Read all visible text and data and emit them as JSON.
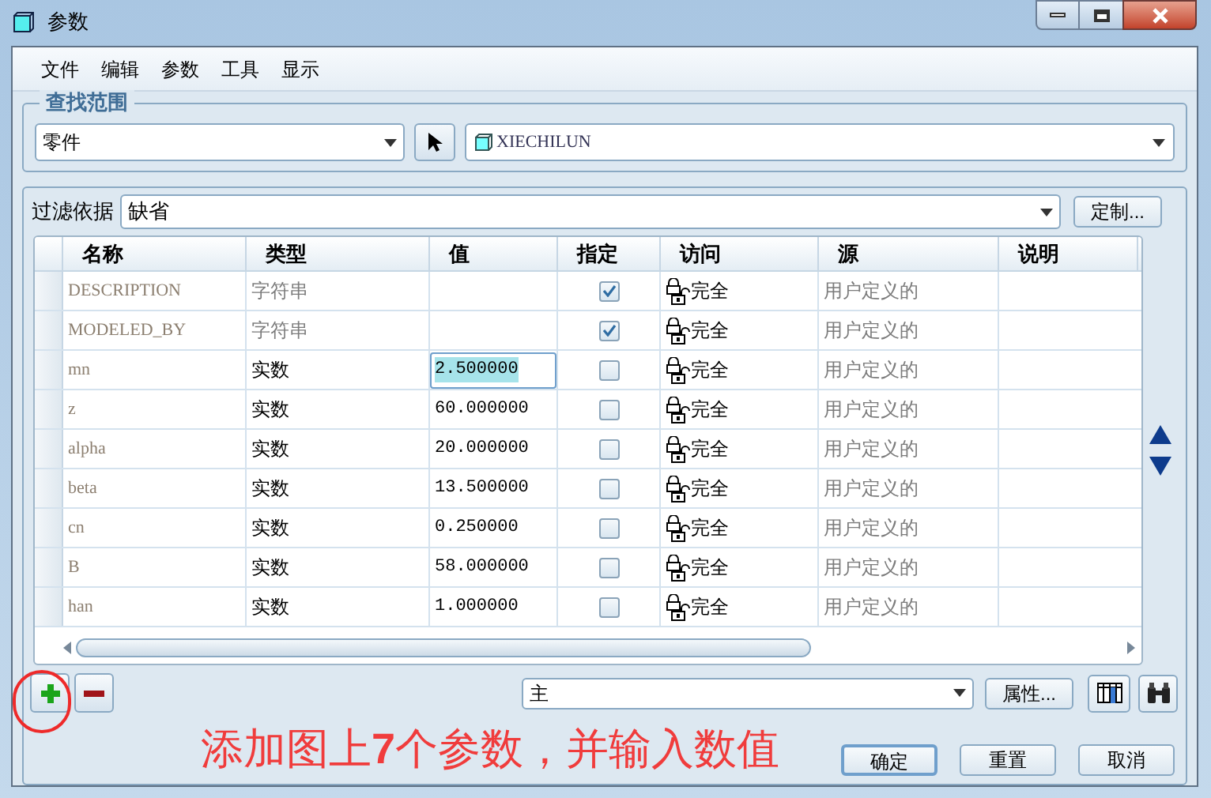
{
  "window": {
    "title": "参数"
  },
  "menu": [
    "文件",
    "编辑",
    "参数",
    "工具",
    "显示"
  ],
  "lookup": {
    "title": "查找范围",
    "scope": "零件",
    "model": "XIECHILUN"
  },
  "filter": {
    "label": "过滤依据",
    "value": "缺省",
    "button": "定制..."
  },
  "table": {
    "columns": [
      "名称",
      "类型",
      "值",
      "指定",
      "访问",
      "源",
      "说明"
    ],
    "rows": [
      {
        "name": "DESCRIPTION",
        "kind": "string",
        "type": "字符串",
        "value": "",
        "checked": true,
        "access": "完全",
        "source": "用户定义的",
        "editing": false
      },
      {
        "name": "MODELED_BY",
        "kind": "string",
        "type": "字符串",
        "value": "",
        "checked": true,
        "access": "完全",
        "source": "用户定义的",
        "editing": false
      },
      {
        "name": "mn",
        "kind": "real",
        "type": "实数",
        "value": "2.500000",
        "checked": false,
        "access": "完全",
        "source": "用户定义的",
        "editing": true
      },
      {
        "name": "z",
        "kind": "real",
        "type": "实数",
        "value": "60.000000",
        "checked": false,
        "access": "完全",
        "source": "用户定义的",
        "editing": false
      },
      {
        "name": "alpha",
        "kind": "real",
        "type": "实数",
        "value": "20.000000",
        "checked": false,
        "access": "完全",
        "source": "用户定义的",
        "editing": false
      },
      {
        "name": "beta",
        "kind": "real",
        "type": "实数",
        "value": "13.500000",
        "checked": false,
        "access": "完全",
        "source": "用户定义的",
        "editing": false
      },
      {
        "name": "cn",
        "kind": "real",
        "type": "实数",
        "value": "0.250000",
        "checked": false,
        "access": "完全",
        "source": "用户定义的",
        "editing": false
      },
      {
        "name": "B",
        "kind": "real",
        "type": "实数",
        "value": "58.000000",
        "checked": false,
        "access": "完全",
        "source": "用户定义的",
        "editing": false
      },
      {
        "name": "han",
        "kind": "real",
        "type": "实数",
        "value": "1.000000",
        "checked": false,
        "access": "完全",
        "source": "用户定义的",
        "editing": false
      }
    ]
  },
  "view": {
    "value": "主",
    "properties_button": "属性..."
  },
  "annotation": "添加图上**7**个参数，并输入数值",
  "buttons": [
    "确定",
    "重置",
    "取消"
  ]
}
